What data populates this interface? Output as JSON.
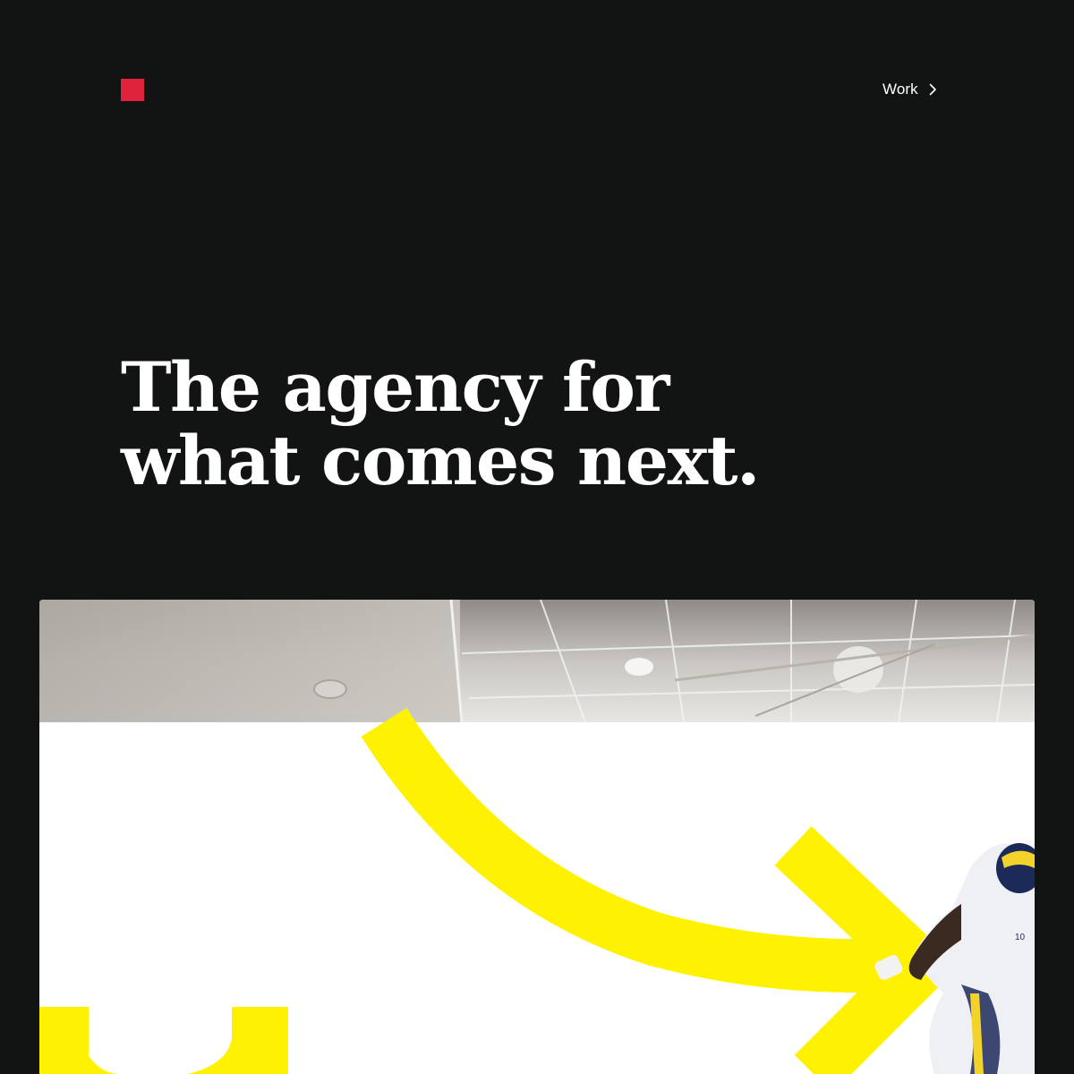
{
  "brand": {
    "logo_color": "#e1223c",
    "logo_icon": "red-square-logo"
  },
  "nav": {
    "work_label": "Work",
    "work_icon": "chevron-right-icon"
  },
  "hero": {
    "headline_line1": "The agency for",
    "headline_line2": "what comes next.",
    "accent_color": "#fff200",
    "image_subject": "football-player"
  }
}
